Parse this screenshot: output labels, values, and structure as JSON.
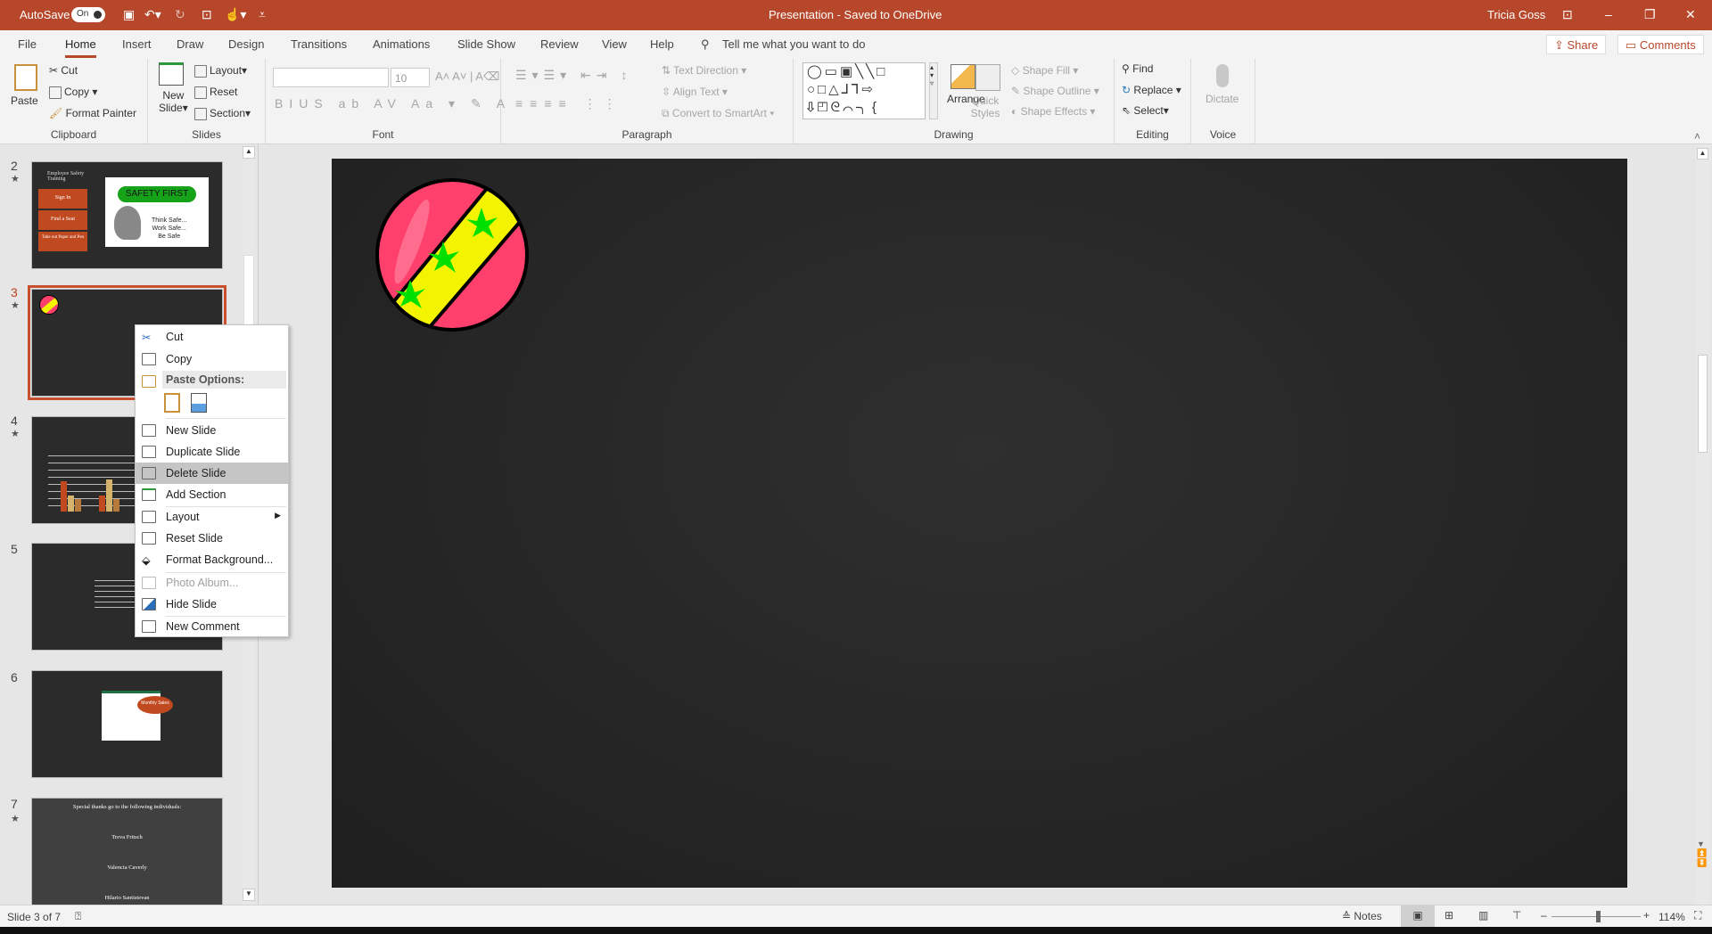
{
  "titlebar": {
    "autosave_label": "AutoSave",
    "autosave_state": "On",
    "title": "Presentation  -  Saved to OneDrive",
    "user": "Tricia Goss",
    "accent": "#b7472a"
  },
  "tabs": [
    "File",
    "Home",
    "Insert",
    "Draw",
    "Design",
    "Transitions",
    "Animations",
    "Slide Show",
    "Review",
    "View",
    "Help"
  ],
  "active_tab": "Home",
  "tell_me": "Tell me what you want to do",
  "share": "Share",
  "comments": "Comments",
  "ribbon": {
    "clipboard": {
      "label": "Clipboard",
      "paste": "Paste",
      "cut": "Cut",
      "copy": "Copy",
      "format_painter": "Format Painter"
    },
    "slides": {
      "label": "Slides",
      "new_slide": "New",
      "new_slide2": "Slide",
      "layout": "Layout",
      "reset": "Reset",
      "section": "Section"
    },
    "font": {
      "label": "Font",
      "size": "10"
    },
    "paragraph": {
      "label": "Paragraph",
      "text_direction": "Text Direction",
      "align_text": "Align Text",
      "smartart": "Convert to SmartArt"
    },
    "drawing": {
      "label": "Drawing",
      "arrange": "Arrange",
      "quick_styles": "Quick",
      "quick_styles2": "Styles",
      "shape_fill": "Shape Fill",
      "shape_outline": "Shape Outline",
      "shape_effects": "Shape Effects"
    },
    "editing": {
      "label": "Editing",
      "find": "Find",
      "replace": "Replace",
      "select": "Select"
    },
    "voice": {
      "label": "Voice",
      "dictate": "Dictate"
    }
  },
  "slides": [
    {
      "num": "2",
      "star": true,
      "title": "Employee Safety Training",
      "items": [
        "Sign In",
        "Find a Seat",
        "Take out Paper and Pen"
      ],
      "banner": "SAFETY FIRST",
      "lines": [
        "Think Safe...",
        "Work Safe...",
        "Be Safe"
      ]
    },
    {
      "num": "3",
      "star": true,
      "selected": true
    },
    {
      "num": "4",
      "star": true
    },
    {
      "num": "5",
      "star": false
    },
    {
      "num": "6",
      "star": false,
      "callout": "Monthly Sales"
    },
    {
      "num": "7",
      "star": true,
      "heading": "Special thanks go to the following individuals:",
      "names": [
        "Treva Fritsch",
        "Valencia Caverly",
        "Hilario Santistevan"
      ]
    }
  ],
  "context_menu": {
    "cut": "Cut",
    "copy": "Copy",
    "paste_options": "Paste Options:",
    "new_slide": "New Slide",
    "duplicate": "Duplicate Slide",
    "delete": "Delete Slide",
    "add_section": "Add Section",
    "layout": "Layout",
    "reset": "Reset Slide",
    "format_bg": "Format Background...",
    "photo_album": "Photo Album...",
    "hide": "Hide Slide",
    "new_comment": "New Comment",
    "highlighted": "Delete Slide"
  },
  "status": {
    "slide_info": "Slide 3 of 7",
    "notes": "Notes",
    "zoom": "114%",
    "zoom_percent": 114
  }
}
